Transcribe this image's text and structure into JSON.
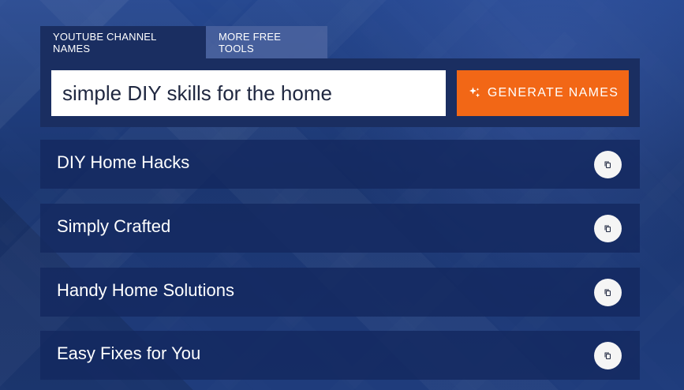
{
  "tabs": {
    "youtube_channel_names": "YOUTUBE CHANNEL NAMES",
    "more_free_tools": "MORE FREE TOOLS"
  },
  "generator": {
    "input_value": "simple DIY skills for the home",
    "generate_label": "GENERATE NAMES",
    "icon": "sparkles-icon"
  },
  "results": [
    {
      "label": "DIY Home Hacks",
      "icon": "copy-icon"
    },
    {
      "label": "Simply Crafted",
      "icon": "copy-icon"
    },
    {
      "label": "Handy Home Solutions",
      "icon": "copy-icon"
    },
    {
      "label": "Easy Fixes for You",
      "icon": "copy-icon"
    }
  ],
  "colors": {
    "background": "#1f3a78",
    "panel": "#1a2e61",
    "accent": "#f26716",
    "white": "#ffffff"
  }
}
